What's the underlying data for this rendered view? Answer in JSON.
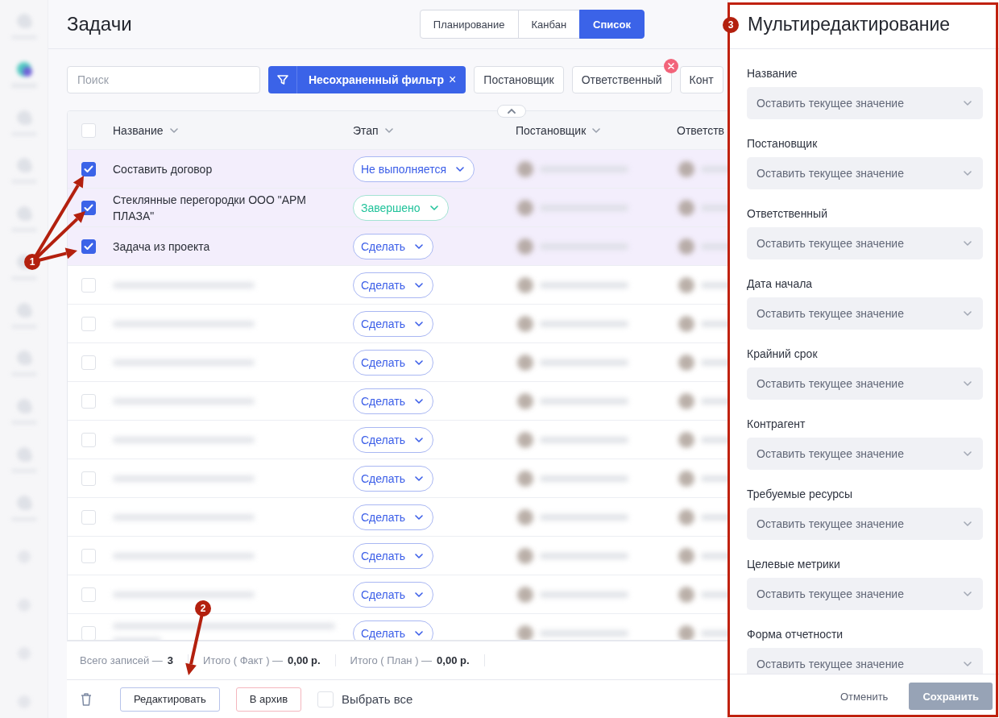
{
  "sidebar": {
    "items": [
      {
        "kind": "labeled",
        "selected": false
      },
      {
        "kind": "labeled",
        "selected": true
      },
      {
        "kind": "labeled",
        "selected": false
      },
      {
        "kind": "labeled",
        "selected": false
      },
      {
        "kind": "labeled",
        "selected": false
      },
      {
        "kind": "labeled",
        "selected": false
      },
      {
        "kind": "labeled",
        "selected": false
      },
      {
        "kind": "labeled",
        "selected": false
      },
      {
        "kind": "labeled",
        "selected": false
      },
      {
        "kind": "labeled",
        "selected": false
      },
      {
        "kind": "labeled",
        "selected": false
      },
      {
        "kind": "icon",
        "selected": false
      },
      {
        "kind": "icon",
        "selected": false
      },
      {
        "kind": "icon",
        "selected": false
      },
      {
        "kind": "icon",
        "selected": false
      }
    ]
  },
  "page_title": "Задачи",
  "view_tabs": [
    {
      "label": "Планирование",
      "selected": false
    },
    {
      "label": "Канбан",
      "selected": false
    },
    {
      "label": "Список",
      "selected": true
    }
  ],
  "search": {
    "placeholder": "Поиск"
  },
  "active_filter": {
    "label": "Несохраненный фильтр",
    "close": "×"
  },
  "filter_chips": [
    {
      "label": "Постановщик",
      "removable": false
    },
    {
      "label": "Ответственный",
      "removable": true
    },
    {
      "label": "Конт",
      "removable": false
    }
  ],
  "table": {
    "header_checkbox": {
      "checked": false
    },
    "columns": [
      "Название",
      "Этап",
      "Постановщик",
      "Ответств"
    ],
    "rows": [
      {
        "kind": "text",
        "name": "Составить договор",
        "selected": true,
        "stage": {
          "label": "Не выполняется",
          "kind": "not_started"
        }
      },
      {
        "kind": "text",
        "name": "Стеклянные перегородки ООО \"АРМ ПЛАЗА\"",
        "selected": true,
        "stage": {
          "label": "Завершено",
          "kind": "done"
        }
      },
      {
        "kind": "text",
        "name": "Задача из проекта",
        "selected": true,
        "stage": {
          "label": "Сделать",
          "kind": "todo"
        }
      },
      {
        "kind": "blurred",
        "selected": false,
        "stage": {
          "label": "Сделать",
          "kind": "todo"
        }
      },
      {
        "kind": "blurred",
        "selected": false,
        "stage": {
          "label": "Сделать",
          "kind": "todo"
        }
      },
      {
        "kind": "blurred",
        "selected": false,
        "stage": {
          "label": "Сделать",
          "kind": "todo"
        }
      },
      {
        "kind": "blurred",
        "selected": false,
        "stage": {
          "label": "Сделать",
          "kind": "todo"
        }
      },
      {
        "kind": "blurred",
        "selected": false,
        "stage": {
          "label": "Сделать",
          "kind": "todo"
        }
      },
      {
        "kind": "blurred",
        "selected": false,
        "stage": {
          "label": "Сделать",
          "kind": "todo"
        }
      },
      {
        "kind": "blurred",
        "selected": false,
        "stage": {
          "label": "Сделать",
          "kind": "todo"
        }
      },
      {
        "kind": "blurred",
        "selected": false,
        "stage": {
          "label": "Сделать",
          "kind": "todo"
        }
      },
      {
        "kind": "blurred",
        "selected": false,
        "stage": {
          "label": "Сделать",
          "kind": "todo"
        }
      },
      {
        "kind": "blurred_long",
        "selected": false,
        "stage": {
          "label": "Сделать",
          "kind": "todo"
        }
      }
    ]
  },
  "totals": [
    {
      "label": "Всего записей —",
      "value": "3"
    },
    {
      "label": "Итого ( Факт ) —",
      "value": "0,00 р."
    },
    {
      "label": "Итого ( План ) —",
      "value": "0,00 р."
    }
  ],
  "actions": {
    "edit": "Редактировать",
    "archive": "В архив",
    "select_all": {
      "label": "Выбрать все",
      "checked": false
    }
  },
  "panel": {
    "title": "Мультиредактирование",
    "fields": [
      {
        "label": "Название",
        "value": "Оставить текущее значение"
      },
      {
        "label": "Постановщик",
        "value": "Оставить текущее значение"
      },
      {
        "label": "Ответственный",
        "value": "Оставить текущее значение"
      },
      {
        "label": "Дата начала",
        "value": "Оставить текущее значение"
      },
      {
        "label": "Крайний срок",
        "value": "Оставить текущее значение"
      },
      {
        "label": "Контрагент",
        "value": "Оставить текущее значение"
      },
      {
        "label": "Требуемые ресурсы",
        "value": "Оставить текущее значение"
      },
      {
        "label": "Целевые метрики",
        "value": "Оставить текущее значение"
      },
      {
        "label": "Форма отчетности",
        "value": "Оставить текущее значение"
      }
    ],
    "cancel": "Отменить",
    "save": {
      "label": "Сохранить",
      "disabled": true
    }
  },
  "annotations": [
    {
      "number": "1"
    },
    {
      "number": "2"
    },
    {
      "number": "3"
    }
  ]
}
